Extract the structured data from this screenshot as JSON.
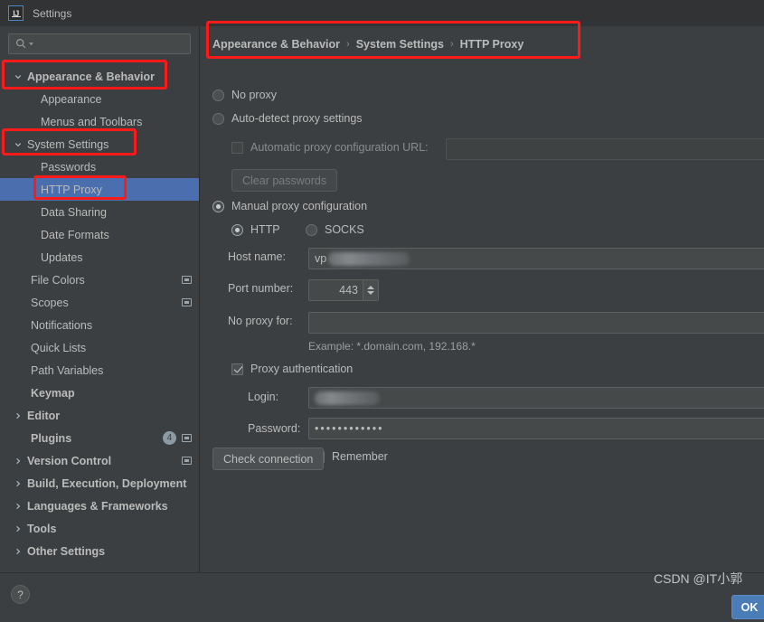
{
  "window": {
    "title": "Settings",
    "logo_text": "IJ"
  },
  "search": {
    "value": "",
    "placeholder": "",
    "icon": "search-icon",
    "dropdown_icon": "chevron-down-icon"
  },
  "sidebar": {
    "items": [
      {
        "label": "Appearance & Behavior",
        "level": 0,
        "bold": true,
        "arrow": "expanded",
        "selected": false,
        "badge": null,
        "scope_icon": false
      },
      {
        "label": "Appearance",
        "level": 1,
        "bold": false,
        "arrow": "none",
        "selected": false,
        "badge": null,
        "scope_icon": false
      },
      {
        "label": "Menus and Toolbars",
        "level": 1,
        "bold": false,
        "arrow": "none",
        "selected": false,
        "badge": null,
        "scope_icon": false
      },
      {
        "label": "System Settings",
        "level": 0,
        "bold": false,
        "arrow": "expanded",
        "selected": false,
        "badge": null,
        "scope_icon": false
      },
      {
        "label": "Passwords",
        "level": 1,
        "bold": false,
        "arrow": "none",
        "selected": false,
        "badge": null,
        "scope_icon": false
      },
      {
        "label": "HTTP Proxy",
        "level": 1,
        "bold": false,
        "arrow": "none",
        "selected": true,
        "badge": null,
        "scope_icon": false
      },
      {
        "label": "Data Sharing",
        "level": 1,
        "bold": false,
        "arrow": "none",
        "selected": false,
        "badge": null,
        "scope_icon": false
      },
      {
        "label": "Date Formats",
        "level": 1,
        "bold": false,
        "arrow": "none",
        "selected": false,
        "badge": null,
        "scope_icon": false
      },
      {
        "label": "Updates",
        "level": 1,
        "bold": false,
        "arrow": "none",
        "selected": false,
        "badge": null,
        "scope_icon": false
      },
      {
        "label": "File Colors",
        "level": 0,
        "bold": false,
        "arrow": "none",
        "selected": false,
        "badge": null,
        "scope_icon": true
      },
      {
        "label": "Scopes",
        "level": 0,
        "bold": false,
        "arrow": "none",
        "selected": false,
        "badge": null,
        "scope_icon": true
      },
      {
        "label": "Notifications",
        "level": 0,
        "bold": false,
        "arrow": "none",
        "selected": false,
        "badge": null,
        "scope_icon": false
      },
      {
        "label": "Quick Lists",
        "level": 0,
        "bold": false,
        "arrow": "none",
        "selected": false,
        "badge": null,
        "scope_icon": false
      },
      {
        "label": "Path Variables",
        "level": 0,
        "bold": false,
        "arrow": "none",
        "selected": false,
        "badge": null,
        "scope_icon": false
      },
      {
        "label": "Keymap",
        "level": 0,
        "bold": true,
        "arrow": "none",
        "selected": false,
        "badge": null,
        "scope_icon": false
      },
      {
        "label": "Editor",
        "level": 0,
        "bold": true,
        "arrow": "collapsed",
        "selected": false,
        "badge": null,
        "scope_icon": false
      },
      {
        "label": "Plugins",
        "level": 0,
        "bold": true,
        "arrow": "none",
        "selected": false,
        "badge": "4",
        "scope_icon": true
      },
      {
        "label": "Version Control",
        "level": 0,
        "bold": true,
        "arrow": "collapsed",
        "selected": false,
        "badge": null,
        "scope_icon": true
      },
      {
        "label": "Build, Execution, Deployment",
        "level": 0,
        "bold": true,
        "arrow": "collapsed",
        "selected": false,
        "badge": null,
        "scope_icon": false
      },
      {
        "label": "Languages & Frameworks",
        "level": 0,
        "bold": true,
        "arrow": "collapsed",
        "selected": false,
        "badge": null,
        "scope_icon": false
      },
      {
        "label": "Tools",
        "level": 0,
        "bold": true,
        "arrow": "collapsed",
        "selected": false,
        "badge": null,
        "scope_icon": false
      },
      {
        "label": "Other Settings",
        "level": 0,
        "bold": true,
        "arrow": "collapsed",
        "selected": false,
        "badge": null,
        "scope_icon": false
      }
    ]
  },
  "breadcrumb": {
    "parts": [
      "Appearance & Behavior",
      "System Settings",
      "HTTP Proxy"
    ],
    "separator": "›"
  },
  "proxy": {
    "no_proxy_label": "No proxy",
    "no_proxy_checked": false,
    "auto_detect_label": "Auto-detect proxy settings",
    "auto_detect_checked": false,
    "auto_url_label": "Automatic proxy configuration URL:",
    "auto_url_checked": false,
    "auto_url_value": "",
    "clear_passwords_label": "Clear passwords",
    "manual_label": "Manual proxy configuration",
    "manual_checked": true,
    "http_label": "HTTP",
    "http_checked": true,
    "socks_label": "SOCKS",
    "socks_checked": false,
    "host_label": "Host name:",
    "host_value": "vp",
    "host_redacted": true,
    "port_label": "Port number:",
    "port_value": "443",
    "no_proxy_for_label": "No proxy for:",
    "no_proxy_for_value": "",
    "example_hint": "Example: *.domain.com, 192.168.*",
    "auth_label": "Proxy authentication",
    "auth_checked": true,
    "login_label": "Login:",
    "login_value": "",
    "login_redacted": true,
    "password_label": "Password:",
    "password_value": "••••••••••••",
    "remember_label": "Remember",
    "remember_checked": true,
    "check_connection_label": "Check connection"
  },
  "footer": {
    "help_label": "?",
    "ok_label": "OK",
    "watermark": "CSDN @IT小郭"
  },
  "colors": {
    "background": "#3c3f41",
    "titlebar": "#313335",
    "selection_blue": "#4b6eaf",
    "accent_button": "#4a7cb8",
    "annotation_red": "#ff1a1a",
    "text": "#bbbbbb"
  },
  "annotations": [
    {
      "name": "appearance-behavior-highlight"
    },
    {
      "name": "system-settings-highlight"
    },
    {
      "name": "http-proxy-highlight"
    },
    {
      "name": "breadcrumb-highlight"
    }
  ]
}
